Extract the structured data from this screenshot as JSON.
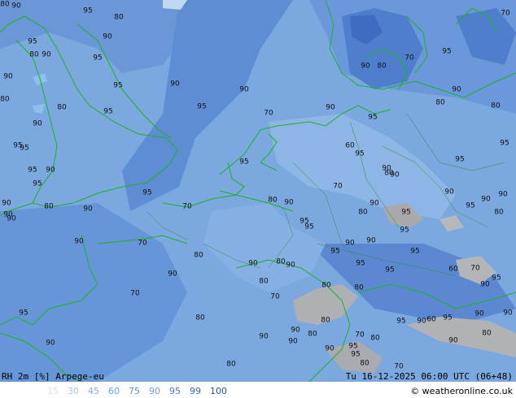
{
  "header": {
    "left": "RH 2m [%] Arpege-eu",
    "right": "Tu 16-12-2025 06:00 UTC (06+48)"
  },
  "legend": {
    "values": [
      {
        "label": "15",
        "color": "#d0e4f2"
      },
      {
        "label": "30",
        "color": "#a6c8e6"
      },
      {
        "label": "45",
        "color": "#7db0df"
      },
      {
        "label": "60",
        "color": "#60a6e6"
      },
      {
        "label": "75",
        "color": "#5c93cf"
      },
      {
        "label": "90",
        "color": "#6e9bd9"
      },
      {
        "label": "95",
        "color": "#4f7ccc"
      },
      {
        "label": "99",
        "color": "#3b64b6"
      },
      {
        "label": "100",
        "color": "#2a4fa0"
      }
    ]
  },
  "copyright": "© weatheronline.co.uk",
  "map_labels": [
    {
      "text": "80"
    },
    {
      "text": "95"
    },
    {
      "text": "80"
    },
    {
      "text": "95"
    },
    {
      "text": "90"
    },
    {
      "text": "80"
    },
    {
      "text": "90"
    },
    {
      "text": "95"
    },
    {
      "text": "90"
    },
    {
      "text": "95"
    },
    {
      "text": "80"
    },
    {
      "text": "80"
    },
    {
      "text": "90"
    },
    {
      "text": "95"
    },
    {
      "text": "90"
    },
    {
      "text": "95"
    },
    {
      "text": "90"
    },
    {
      "text": "95"
    },
    {
      "text": "90"
    },
    {
      "text": "95"
    },
    {
      "text": "95"
    },
    {
      "text": "90"
    },
    {
      "text": "95"
    },
    {
      "text": "95"
    },
    {
      "text": "90"
    },
    {
      "text": "90"
    },
    {
      "text": "80"
    },
    {
      "text": "90"
    },
    {
      "text": "70"
    },
    {
      "text": "80"
    },
    {
      "text": "90"
    },
    {
      "text": "70"
    },
    {
      "text": "80"
    },
    {
      "text": "90"
    },
    {
      "text": "95"
    },
    {
      "text": "90"
    },
    {
      "text": "80"
    },
    {
      "text": "90"
    },
    {
      "text": "95"
    },
    {
      "text": "90"
    },
    {
      "text": "95"
    },
    {
      "text": "95"
    },
    {
      "text": "90"
    },
    {
      "text": "95"
    },
    {
      "text": "90"
    },
    {
      "text": "80"
    },
    {
      "text": "90"
    },
    {
      "text": "95"
    },
    {
      "text": "95"
    },
    {
      "text": "95"
    },
    {
      "text": "70"
    },
    {
      "text": "80"
    },
    {
      "text": "90"
    },
    {
      "text": "80"
    },
    {
      "text": "70"
    },
    {
      "text": "80"
    },
    {
      "text": "90"
    },
    {
      "text": "90"
    },
    {
      "text": "70"
    },
    {
      "text": "80"
    },
    {
      "text": "90"
    },
    {
      "text": "90"
    },
    {
      "text": "80"
    },
    {
      "text": "90"
    },
    {
      "text": "80"
    },
    {
      "text": "95"
    },
    {
      "text": "95"
    },
    {
      "text": "95"
    },
    {
      "text": "60"
    },
    {
      "text": "70"
    },
    {
      "text": "90"
    },
    {
      "text": "95"
    },
    {
      "text": "80"
    },
    {
      "text": "80"
    },
    {
      "text": "70"
    },
    {
      "text": "95"
    },
    {
      "text": "70"
    },
    {
      "text": "80"
    },
    {
      "text": "90"
    },
    {
      "text": "90"
    },
    {
      "text": "90"
    },
    {
      "text": "90"
    },
    {
      "text": "80"
    },
    {
      "text": "70"
    },
    {
      "text": "80"
    },
    {
      "text": "60"
    },
    {
      "text": "95"
    },
    {
      "text": "90"
    },
    {
      "text": "95"
    },
    {
      "text": "90"
    },
    {
      "text": "90"
    },
    {
      "text": "80"
    },
    {
      "text": "90"
    },
    {
      "text": "90"
    },
    {
      "text": "95"
    },
    {
      "text": "95"
    },
    {
      "text": "80"
    },
    {
      "text": "70"
    },
    {
      "text": "80"
    },
    {
      "text": "90"
    },
    {
      "text": "95"
    },
    {
      "text": "90"
    },
    {
      "text": "95"
    },
    {
      "text": "70"
    },
    {
      "text": "60"
    },
    {
      "text": "95"
    },
    {
      "text": "90"
    },
    {
      "text": "95"
    },
    {
      "text": "80"
    },
    {
      "text": "95"
    },
    {
      "text": "90"
    }
  ]
}
